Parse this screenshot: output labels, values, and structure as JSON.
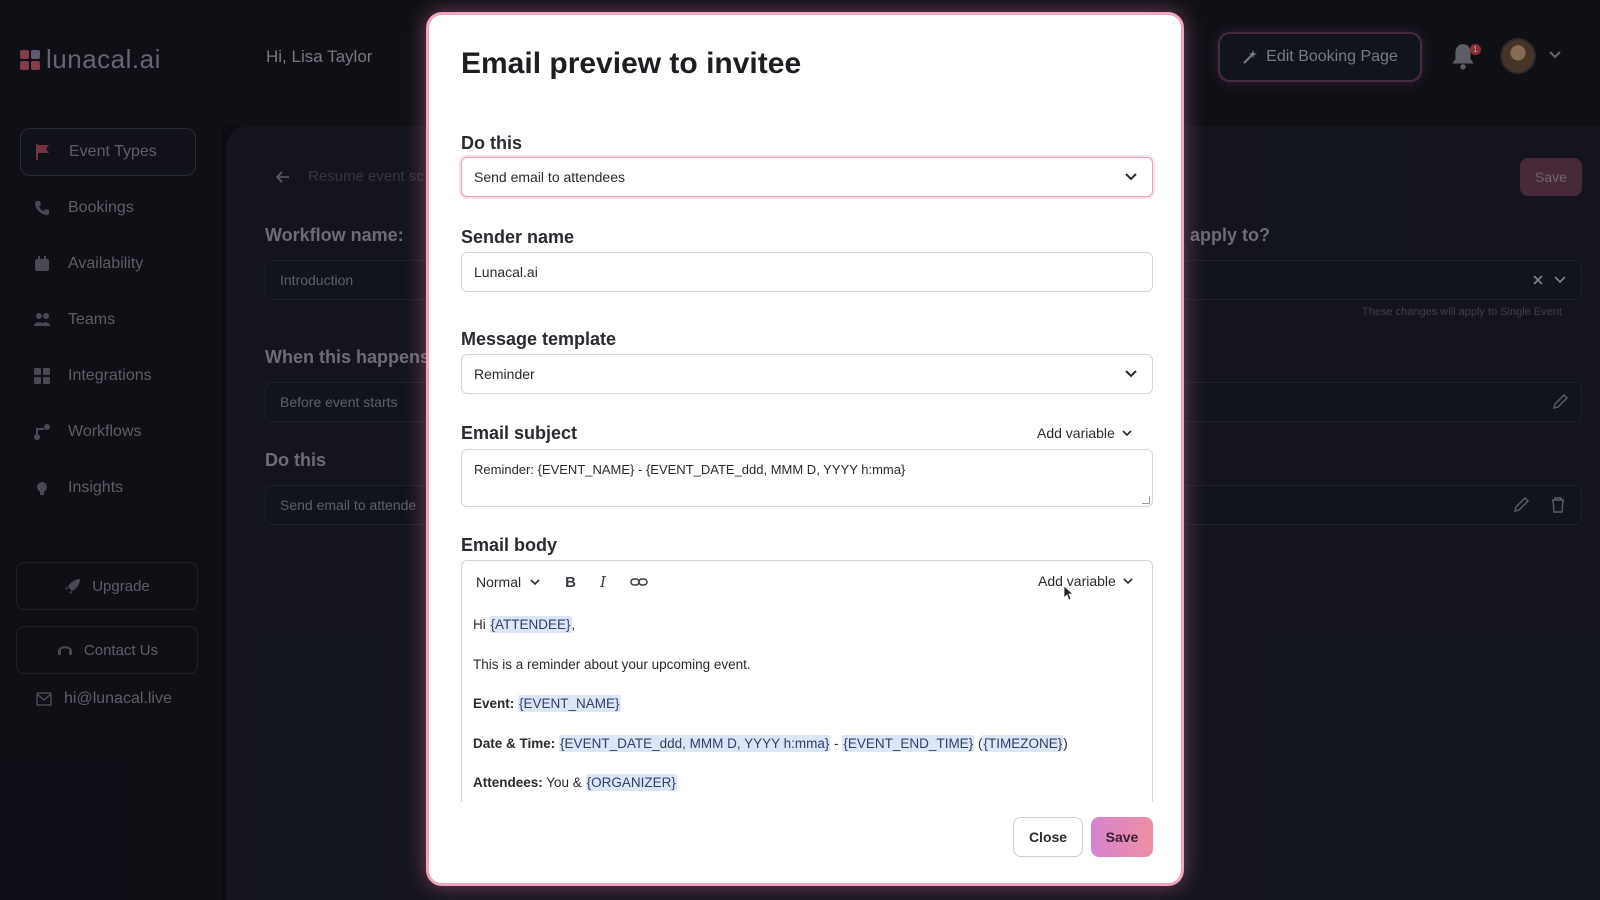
{
  "app": {
    "logo_text": "lunacal.ai",
    "greeting": "Hi, Lisa Taylor",
    "edit_booking_label": "Edit Booking Page",
    "notification_count": "1"
  },
  "sidebar": {
    "items": [
      {
        "label": "Event Types",
        "icon": "flag-icon"
      },
      {
        "label": "Bookings",
        "icon": "phone-icon"
      },
      {
        "label": "Availability",
        "icon": "calendar-icon"
      },
      {
        "label": "Teams",
        "icon": "people-icon"
      },
      {
        "label": "Integrations",
        "icon": "grid-icon"
      },
      {
        "label": "Workflows",
        "icon": "workflow-icon"
      },
      {
        "label": "Insights",
        "icon": "bulb-icon"
      }
    ],
    "upgrade_label": "Upgrade",
    "contact_label": "Contact Us",
    "email": "hi@lunacal.live"
  },
  "background": {
    "breadcrumb": "Resume event sc",
    "workflow_name_label": "Workflow name:",
    "workflow_name_value": "Introduction",
    "when_label": "When this happens",
    "when_value": "Before event starts",
    "do_this_label": "Do this",
    "do_this_value": "Send email to attende",
    "apply_to_label": "apply to?",
    "apply_note": "These changes will apply to Single Event",
    "save_label": "Save"
  },
  "modal": {
    "title": "Email preview to invitee",
    "do_this_label": "Do this",
    "do_this_value": "Send email to attendees",
    "sender_name_label": "Sender name",
    "sender_name_value": "Lunacal.ai",
    "message_template_label": "Message template",
    "message_template_value": "Reminder",
    "email_subject_label": "Email subject",
    "add_variable_label": "Add variable",
    "email_subject_value": "Reminder: {EVENT_NAME} - {EVENT_DATE_ddd, MMM D, YYYY h:mma}",
    "email_body_label": "Email body",
    "toolbar": {
      "format": "Normal",
      "bold": "B",
      "italic": "I"
    },
    "body": {
      "greeting_prefix": "Hi ",
      "greeting_var": "{ATTENDEE}",
      "greeting_suffix": ",",
      "line2": "This is a reminder about your upcoming event.",
      "event_label": "Event:",
      "event_var": "{EVENT_NAME}",
      "datetime_label": "Date & Time:",
      "datetime_var": "{EVENT_DATE_ddd, MMM D, YYYY h:mma}",
      "datetime_sep": " - ",
      "end_var": "{EVENT_END_TIME}",
      "tz_open": " (",
      "tz_var": "{TIMEZONE}",
      "tz_close": ")",
      "attendees_label": "Attendees:",
      "attendees_text": " You & ",
      "organizer_var": "{ORGANIZER}"
    },
    "close_label": "Close",
    "save_label": "Save"
  }
}
